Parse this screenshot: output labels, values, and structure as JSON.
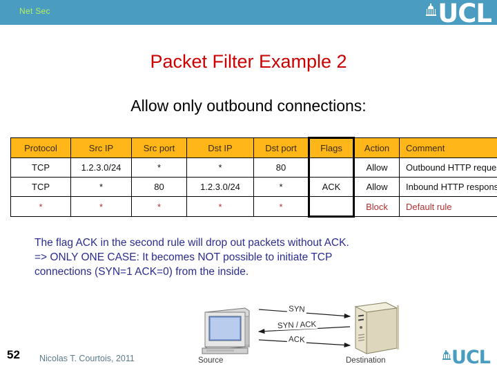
{
  "header": {
    "label": "Net Sec",
    "label_text": "Net Sec",
    "logo_text": "UCL",
    "bar_color": "#4a9cc0",
    "label_color": "#b8f060"
  },
  "slide": {
    "title": "Packet Filter Example 2",
    "title_color": "#cc0000",
    "subtitle": "Allow only outbound connections:"
  },
  "table": {
    "header_bg": "#ffb619",
    "columns": [
      "Protocol",
      "Src IP",
      "Src port",
      "Dst IP",
      "Dst port",
      "Flags",
      "Action",
      "Comment"
    ],
    "highlighted_column": "Flags",
    "rows": [
      {
        "protocol": "TCP",
        "src_ip": "1.2.3.0/24",
        "src_port": "*",
        "dst_ip": "*",
        "dst_port": "80",
        "flags": "",
        "action": "Allow",
        "comment": "Outbound HTTP requests"
      },
      {
        "protocol": "TCP",
        "src_ip": "*",
        "src_port": "80",
        "dst_ip": "1.2.3.0/24",
        "dst_port": "*",
        "flags": "ACK",
        "action": "Allow",
        "comment": "Inbound HTTP responses"
      },
      {
        "protocol": "*",
        "src_ip": "*",
        "src_port": "*",
        "dst_ip": "*",
        "dst_port": "*",
        "flags": "",
        "action": "Block",
        "comment": "Default rule"
      }
    ]
  },
  "explanation": {
    "line1": "The flag ACK in the second rule will drop out packets without ACK.",
    "line2": "=> ONLY ONE CASE: It becomes NOT possible to initiate TCP",
    "line3": "connections (SYN=1 ACK=0) from the inside.",
    "color": "#2b2b8f"
  },
  "figure": {
    "source_label": "Source",
    "destination_label": "Destination",
    "messages": [
      {
        "label": "SYN",
        "direction": "right"
      },
      {
        "label": "SYN / ACK",
        "direction": "left"
      },
      {
        "label": "ACK",
        "direction": "right"
      }
    ]
  },
  "footer": {
    "page_number": "52",
    "author": "Nicolas T. Courtois, 2011",
    "logo_text": "UCL"
  }
}
